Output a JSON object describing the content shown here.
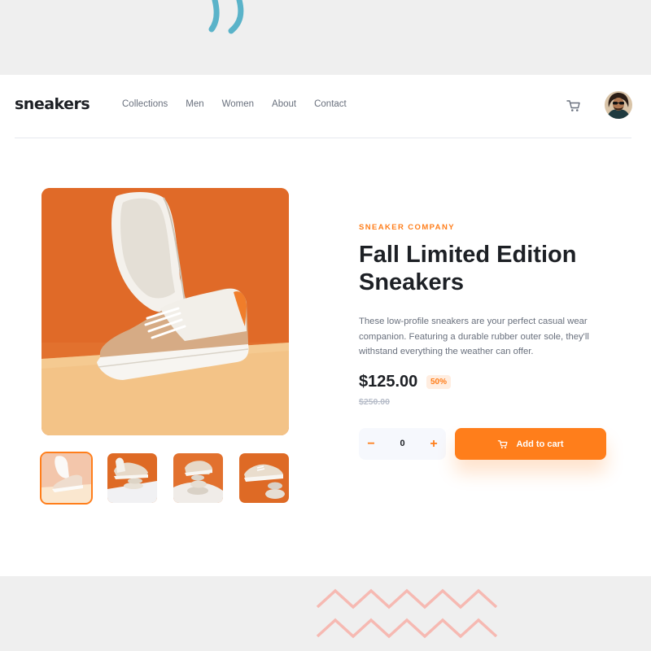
{
  "header": {
    "logo": "sneakers",
    "nav": [
      "Collections",
      "Men",
      "Women",
      "About",
      "Contact"
    ],
    "cart_icon": "cart-icon",
    "avatar_icon": "user-avatar"
  },
  "gallery": {
    "main_image": "product-image-1",
    "thumbnails": [
      "thumbnail-1",
      "thumbnail-2",
      "thumbnail-3",
      "thumbnail-4"
    ],
    "active_index": 0
  },
  "product": {
    "company": "SNEAKER COMPANY",
    "title_line1": "Fall Limited Edition",
    "title_line2": "Sneakers",
    "description": "These low-profile sneakers are your perfect casual wear companion. Featuring a durable rubber outer sole, they'll withstand everything the weather can offer.",
    "price": "$125.00",
    "discount": "50%",
    "original_price": "$250.00"
  },
  "cart_controls": {
    "minus": "−",
    "quantity": "0",
    "plus": "+",
    "add_label": "Add to cart",
    "add_icon": "cart-icon"
  },
  "colors": {
    "accent": "#ff7e1b",
    "accent_pale": "#ffede0",
    "text_dark": "#1d2025",
    "text_grey": "#69707d",
    "background": "#efefef"
  }
}
